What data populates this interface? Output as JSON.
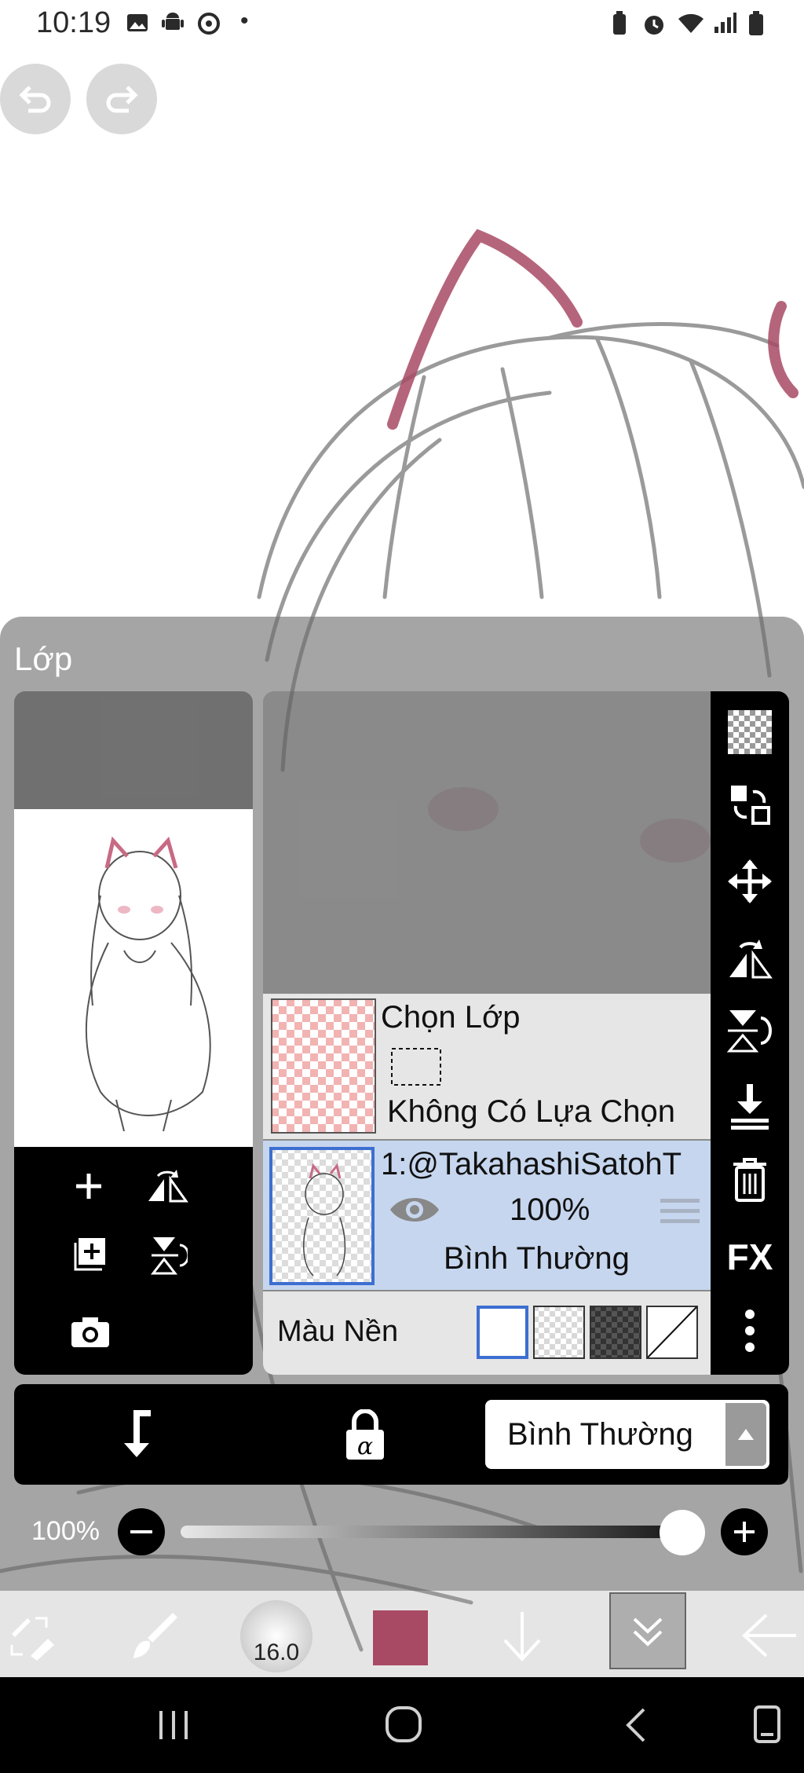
{
  "status_bar": {
    "time": "10:19",
    "dot": "•"
  },
  "panel": {
    "title": "Lớp"
  },
  "layers": {
    "selection_layer": {
      "title": "Chọn Lớp",
      "subtitle": "Không Có Lựa Chọn"
    },
    "layer1": {
      "name": "1:@TakahashiSatohT",
      "opacity": "100%",
      "blend": "Bình Thường"
    },
    "background": {
      "label": "Màu Nền"
    }
  },
  "right_tools": {
    "fx_label": "FX"
  },
  "blend_mode": {
    "value": "Bình Thường"
  },
  "opacity": {
    "label": "100%",
    "value": 1.0
  },
  "brush": {
    "size": "16.0"
  },
  "colors": {
    "primary": "#a84a64",
    "layer_selected": "#c6d6ee",
    "accent_border": "#3d6fd1"
  }
}
